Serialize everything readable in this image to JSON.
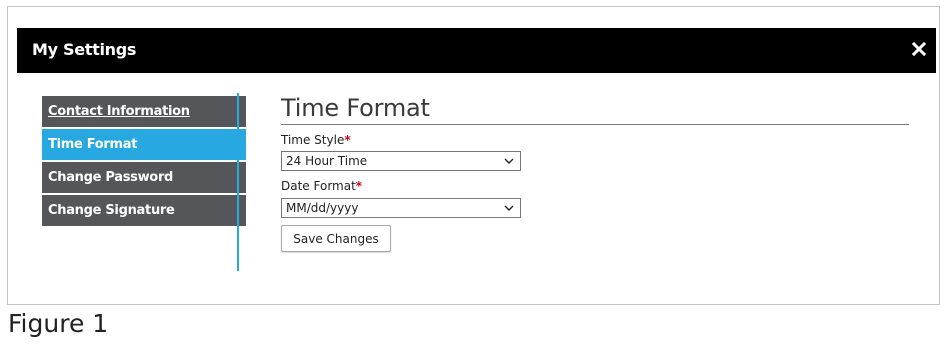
{
  "dialog": {
    "title": "My Settings",
    "close_icon": "close-icon"
  },
  "nav": {
    "items": [
      {
        "label": "Contact Information",
        "state": "link"
      },
      {
        "label": "Time Format",
        "state": "active"
      },
      {
        "label": "Change Password",
        "state": "normal"
      },
      {
        "label": "Change Signature",
        "state": "normal"
      }
    ]
  },
  "content": {
    "heading": "Time Format",
    "time_style": {
      "label": "Time Style",
      "required_mark": "*",
      "selected": "24 Hour Time"
    },
    "date_format": {
      "label": "Date Format",
      "required_mark": "*",
      "selected": "MM/dd/yyyy"
    },
    "save_label": "Save Changes"
  },
  "caption": "Figure 1",
  "colors": {
    "titlebar": "#000000",
    "nav_bg": "#555659",
    "nav_active": "#27a8e0",
    "required": "#d0021b"
  }
}
